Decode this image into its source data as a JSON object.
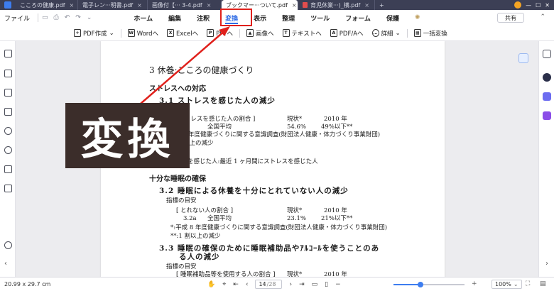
{
  "tabs": [
    {
      "label": "こころの健康.pdf",
      "active": false
    },
    {
      "label": "電子レン···明書.pdf",
      "active": false
    },
    {
      "label": "画像付【··· 3-4.pdf",
      "active": false
    },
    {
      "label": "ブックマー···ついて.pdf",
      "active": true
    },
    {
      "label": "育児休業···)_横.pdf",
      "active": false
    }
  ],
  "tab_close": "×",
  "tab_add": "+",
  "menubar": {
    "file_label": "ファイル",
    "tabs": [
      "ホーム",
      "編集",
      "注釈",
      "変換",
      "表示",
      "整理",
      "ツール",
      "フォーム",
      "保護"
    ],
    "active_tab": "変換",
    "share_label": "共有"
  },
  "ribbon": {
    "items": [
      {
        "label": "PDF作成",
        "icon": "pdf-create-icon",
        "dropdown": true
      },
      {
        "label": "Wordへ",
        "icon": "word-icon"
      },
      {
        "label": "Excelへ",
        "icon": "excel-icon"
      },
      {
        "label": "PPTへ",
        "icon": "ppt-icon"
      },
      {
        "label": "画像へ",
        "icon": "image-icon"
      },
      {
        "label": "テキストへ",
        "icon": "text-icon"
      },
      {
        "label": "PDF/Aへ",
        "icon": "pdfa-icon"
      },
      {
        "label": "詳細",
        "icon": "more-icon",
        "dropdown": true
      },
      {
        "label": "一括変換",
        "icon": "batch-convert-icon"
      }
    ]
  },
  "overlay": {
    "label": "変換"
  },
  "document": {
    "lines": [
      {
        "text": "3 休養:こころの健康づくり",
        "cls": "h1"
      },
      {
        "text": "ストレスへの対応",
        "cls": "sec"
      },
      {
        "text": "3.1 ストレスを感じた人の減少",
        "cls": "h2"
      },
      {
        "text": "[ストレスを感じた人の割合 ]",
        "cls": ""
      },
      {
        "text": "現状*",
        "cls": ""
      },
      {
        "text": "2010 年",
        "cls": ""
      },
      {
        "text": "全国平均",
        "cls": ""
      },
      {
        "text": "54.6%",
        "cls": ""
      },
      {
        "text": "49%以下**",
        "cls": ""
      },
      {
        "text": "*:平成 8 年度健康づくりに関する意識調査(財団法人健康・体力づくり事業財団)",
        "cls": ""
      },
      {
        "text": "**:1 割以上の減少",
        "cls": ""
      },
      {
        "text": "ストレスを感じた人:最近 1 ヶ月間にストレスを感じた人",
        "cls": ""
      },
      {
        "text": "十分な睡眠の確保",
        "cls": "sec"
      },
      {
        "text": "3.2 睡眠による休養を十分にとれていない人の減少",
        "cls": "h2"
      },
      {
        "text": "指標の目安",
        "cls": ""
      },
      {
        "text": "[ とれない人の割合 ]",
        "cls": ""
      },
      {
        "text": "現状*",
        "cls": ""
      },
      {
        "text": "2010 年",
        "cls": ""
      },
      {
        "text": "3.2a",
        "cls": ""
      },
      {
        "text": "全国平均",
        "cls": ""
      },
      {
        "text": "23.1%",
        "cls": ""
      },
      {
        "text": "21%以下**",
        "cls": ""
      },
      {
        "text": "*:平成 8 年度健康づくりに関する意識調査(財団法人健康・体力づくり事業財団)",
        "cls": ""
      },
      {
        "text": "**:1 割以上の減少",
        "cls": ""
      },
      {
        "text": "3.3 睡眠の確保のために睡眠補助品やｱﾙｺｰﾙを使うことのあ",
        "cls": "h2"
      },
      {
        "text": "る人の減少",
        "cls": "h2"
      },
      {
        "text": "指標の目安",
        "cls": ""
      },
      {
        "text": "[ 睡眠補助品等を使用する人の割合 ]",
        "cls": ""
      },
      {
        "text": "現状*",
        "cls": ""
      },
      {
        "text": "2010 年",
        "cls": ""
      }
    ]
  },
  "statusbar": {
    "dimensions": "20.99 x 29.7 cm",
    "current_page": "14",
    "total_pages": "/28",
    "zoom": "100%",
    "zoom_fraction": 0.38
  },
  "colors": {
    "accent": "#2f6ce5",
    "highlight": "#e0201b",
    "overlay_bg": "#3b2d2a",
    "tabstrip_bg": "#3c3f55"
  }
}
